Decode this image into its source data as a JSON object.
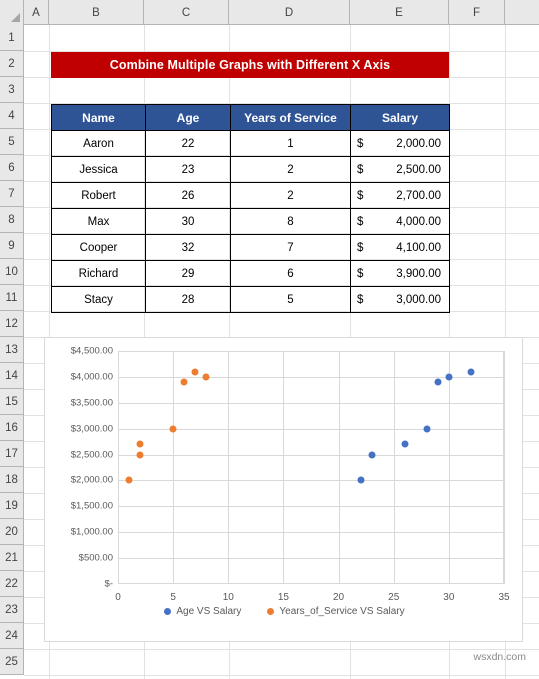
{
  "app": {
    "watermark": "wsxdn.com"
  },
  "grid": {
    "column_headers": [
      "A",
      "B",
      "C",
      "D",
      "E",
      "F"
    ],
    "column_edges": [
      24,
      49,
      144,
      229,
      350,
      449,
      505,
      539
    ],
    "row_headers": [
      "1",
      "2",
      "3",
      "4",
      "5",
      "6",
      "7",
      "8",
      "9",
      "10",
      "11",
      "12",
      "13",
      "14",
      "15",
      "16",
      "17",
      "18",
      "19",
      "20",
      "21",
      "22",
      "23",
      "24",
      "25"
    ]
  },
  "title": {
    "text": "Combine Multiple Graphs with Different X Axis",
    "background": "#C00000",
    "color": "#FFFFFF"
  },
  "table": {
    "header_background": "#2F5496",
    "headers": [
      "Name",
      "Age",
      "Years of Service",
      "Salary"
    ],
    "rows": [
      {
        "name": "Aaron",
        "age": "22",
        "years": "1",
        "salary_symbol": "$",
        "salary": "2,000.00"
      },
      {
        "name": "Jessica",
        "age": "23",
        "years": "2",
        "salary_symbol": "$",
        "salary": "2,500.00"
      },
      {
        "name": "Robert",
        "age": "26",
        "years": "2",
        "salary_symbol": "$",
        "salary": "2,700.00"
      },
      {
        "name": "Max",
        "age": "30",
        "years": "8",
        "salary_symbol": "$",
        "salary": "4,000.00"
      },
      {
        "name": "Cooper",
        "age": "32",
        "years": "7",
        "salary_symbol": "$",
        "salary": "4,100.00"
      },
      {
        "name": "Richard",
        "age": "29",
        "years": "6",
        "salary_symbol": "$",
        "salary": "3,900.00"
      },
      {
        "name": "Stacy",
        "age": "28",
        "years": "5",
        "salary_symbol": "$",
        "salary": "3,000.00"
      }
    ]
  },
  "chart_data": {
    "type": "scatter",
    "title": "",
    "xlabel": "",
    "ylabel": "",
    "xlim": [
      0,
      35
    ],
    "ylim": [
      0,
      4500
    ],
    "xticks": [
      0,
      5,
      10,
      15,
      20,
      25,
      30,
      35
    ],
    "xtick_labels": [
      "0",
      "5",
      "10",
      "15",
      "20",
      "25",
      "30",
      "35"
    ],
    "yticks": [
      0,
      500,
      1000,
      1500,
      2000,
      2500,
      3000,
      3500,
      4000,
      4500
    ],
    "ytick_labels": [
      "$-",
      "$500.00",
      "$1,000.00",
      "$1,500.00",
      "$2,000.00",
      "$2,500.00",
      "$3,000.00",
      "$3,500.00",
      "$4,000.00",
      "$4,500.00"
    ],
    "grid": true,
    "legend_position": "bottom",
    "series": [
      {
        "name": "Age VS Salary",
        "color": "#4472C4",
        "x": [
          22,
          23,
          26,
          30,
          32,
          29,
          28
        ],
        "y": [
          2000,
          2500,
          2700,
          4000,
          4100,
          3900,
          3000
        ]
      },
      {
        "name": "Years_of_Service VS Salary",
        "color": "#ED7D31",
        "x": [
          1,
          2,
          2,
          8,
          7,
          6,
          5
        ],
        "y": [
          2000,
          2500,
          2700,
          4000,
          4100,
          3900,
          3000
        ]
      }
    ]
  }
}
